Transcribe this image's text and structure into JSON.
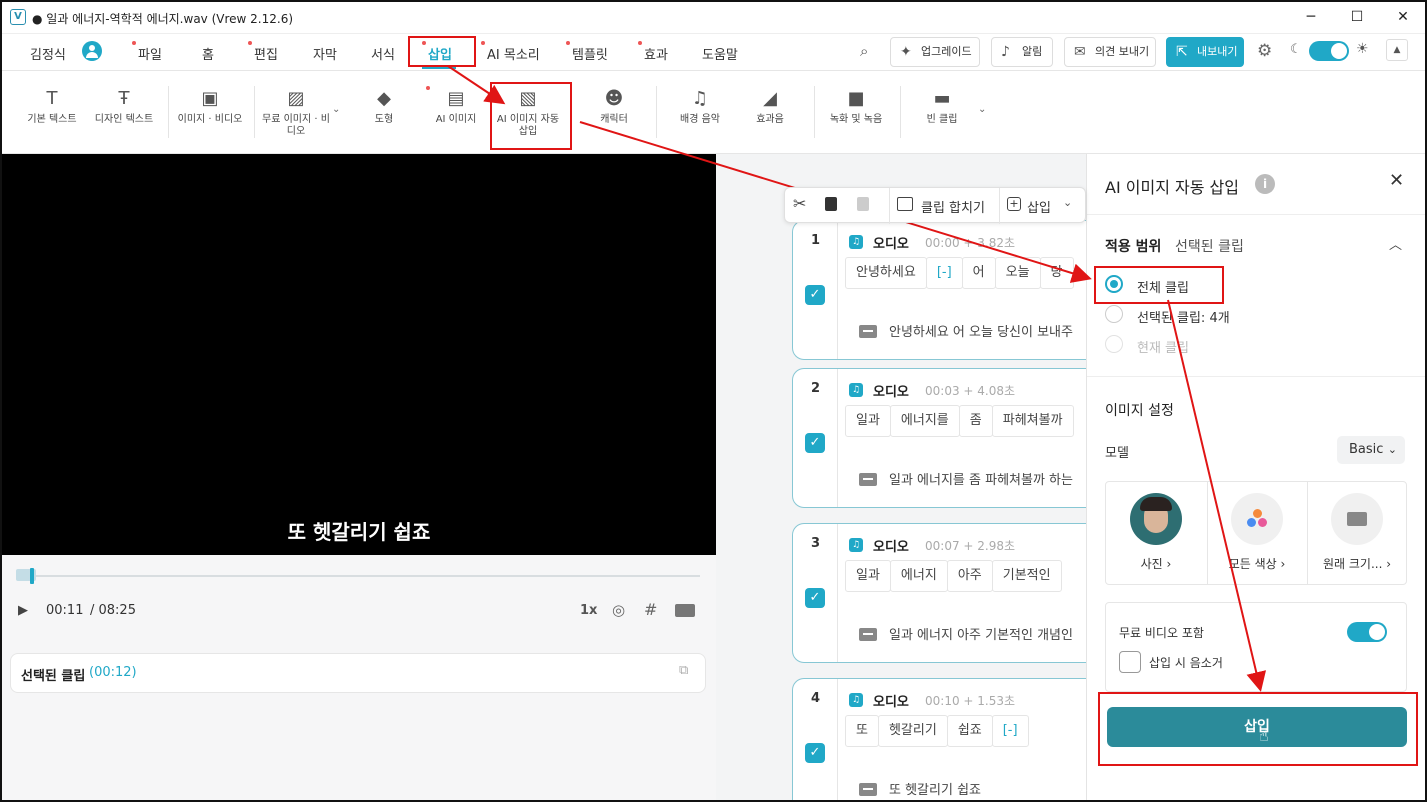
{
  "window": {
    "title": "● 일과 에너지-역학적 에너지.wav (Vrew 2.12.6)",
    "logo": "V",
    "minimize": "─",
    "maximize": "☐",
    "close": "✕"
  },
  "menubar": {
    "user": "김정식",
    "items": [
      "파일",
      "홈",
      "편집",
      "자막",
      "서식",
      "삽입",
      "AI 목소리",
      "템플릿",
      "효과",
      "도움말"
    ],
    "upgrade": "업그레이드",
    "notifications": "알림",
    "feedback": "의견 보내기",
    "export": "내보내기"
  },
  "ribbon": {
    "items": [
      "기본 텍스트",
      "디자인 텍스트",
      "이미지 · 비디오",
      "무료 이미지 · 비디오",
      "도형",
      "AI 이미지",
      "AI 이미지 자동 삽입",
      "캐릭터",
      "배경 음악",
      "효과음",
      "녹화 및 녹음",
      "빈 클립"
    ]
  },
  "player": {
    "subtitle": "또 헷갈리기 쉽죠",
    "current_time": "00:11",
    "total_time": "/ 08:25",
    "speed": "1x",
    "progress": 0.02,
    "selected_clip_label": "선택된 클립",
    "selected_clip_time": "(00:12)"
  },
  "timeline": {
    "toolbar": {
      "merge": "클립 합치기",
      "insert": "삽입"
    },
    "clips": [
      {
        "num": "1",
        "label": "오디오",
        "time": "00:00 + 3.82초",
        "words": [
          "안녕하세요",
          "[-]",
          "어",
          "오늘",
          "당"
        ],
        "subtitle": "안녕하세요 어 오늘 당신이 보내주"
      },
      {
        "num": "2",
        "label": "오디오",
        "time": "00:03 + 4.08초",
        "words": [
          "일과",
          "에너지를",
          "좀",
          "파헤쳐볼까"
        ],
        "subtitle": "일과 에너지를 좀 파헤쳐볼까 하는"
      },
      {
        "num": "3",
        "label": "오디오",
        "time": "00:07 + 2.98초",
        "words": [
          "일과",
          "에너지",
          "아주",
          "기본적인"
        ],
        "subtitle": "일과 에너지 아주 기본적인 개념인"
      },
      {
        "num": "4",
        "label": "오디오",
        "time": "00:10 + 1.53초",
        "words": [
          "또",
          "헷갈리기",
          "쉽죠",
          "[-]"
        ],
        "subtitle": "또 헷갈리기 쉽죠"
      }
    ]
  },
  "panel": {
    "title": "AI 이미지 자동 삽입",
    "scope_label": "적용 범위",
    "scope_value": "선택된 클립",
    "options": [
      "전체 클립",
      "선택된 클립: 4개",
      "현재 클립"
    ],
    "image_settings": "이미지 설정",
    "model_label": "모델",
    "model_value": "Basic",
    "model_cards": [
      "사진",
      "모든 색상",
      "원래 크기..."
    ],
    "free_video": "무료 비디오 포함",
    "remove_audio": "삽입 시 음소거",
    "insert_button": "삽입"
  },
  "colors": {
    "accent": "#20a8c7",
    "annotation": "#e01515"
  }
}
